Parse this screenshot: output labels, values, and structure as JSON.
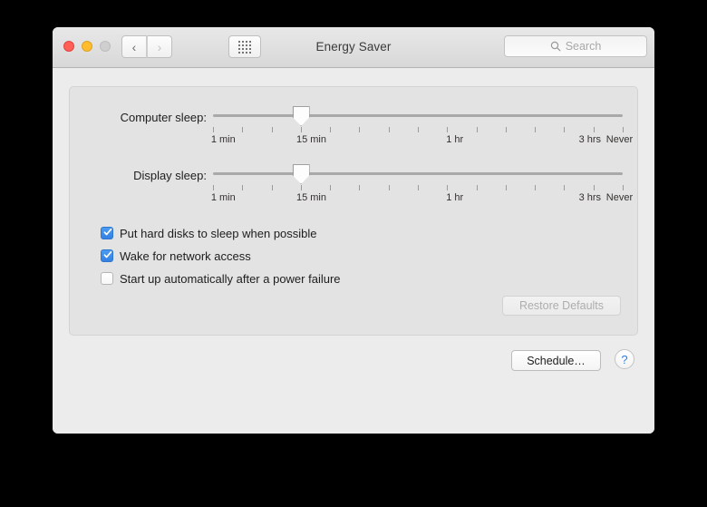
{
  "window": {
    "title": "Energy Saver",
    "traffic_lights": [
      {
        "name": "close",
        "color": "#ff5f57"
      },
      {
        "name": "minimize",
        "color": "#ffbd2e"
      },
      {
        "name": "maximize",
        "color": "#cfcfcf"
      }
    ],
    "nav": {
      "back_glyph": "‹",
      "forward_glyph": "›",
      "back_enabled": true,
      "forward_enabled": false
    },
    "grid_button_name": "show-all-preferences",
    "search": {
      "placeholder": "Search",
      "value": ""
    }
  },
  "sliders": [
    {
      "label": "Computer sleep:",
      "value_percent": 21.5,
      "tick_count": 15,
      "tick_labels": [
        {
          "text": "1 min",
          "percent": 0
        },
        {
          "text": "15 min",
          "percent": 24
        },
        {
          "text": "1 hr",
          "percent": 59
        },
        {
          "text": "3 hrs",
          "percent": 92
        },
        {
          "text": "Never",
          "percent": 100
        }
      ]
    },
    {
      "label": "Display sleep:",
      "value_percent": 21.5,
      "tick_count": 15,
      "tick_labels": [
        {
          "text": "1 min",
          "percent": 0
        },
        {
          "text": "15 min",
          "percent": 24
        },
        {
          "text": "1 hr",
          "percent": 59
        },
        {
          "text": "3 hrs",
          "percent": 92
        },
        {
          "text": "Never",
          "percent": 100
        }
      ]
    }
  ],
  "checkboxes": [
    {
      "label": "Put hard disks to sleep when possible",
      "checked": true
    },
    {
      "label": "Wake for network access",
      "checked": true
    },
    {
      "label": "Start up automatically after a power failure",
      "checked": false
    }
  ],
  "buttons": {
    "restore_defaults": {
      "label": "Restore Defaults",
      "enabled": false
    },
    "schedule": {
      "label": "Schedule…",
      "enabled": true
    },
    "help": {
      "label": "?",
      "enabled": true
    }
  },
  "colors": {
    "accent": "#3481e4",
    "help_blue": "#2b7fe3",
    "window_bg": "#ececec",
    "panel_bg": "#e3e3e3",
    "desktop_bg": "#000000"
  }
}
